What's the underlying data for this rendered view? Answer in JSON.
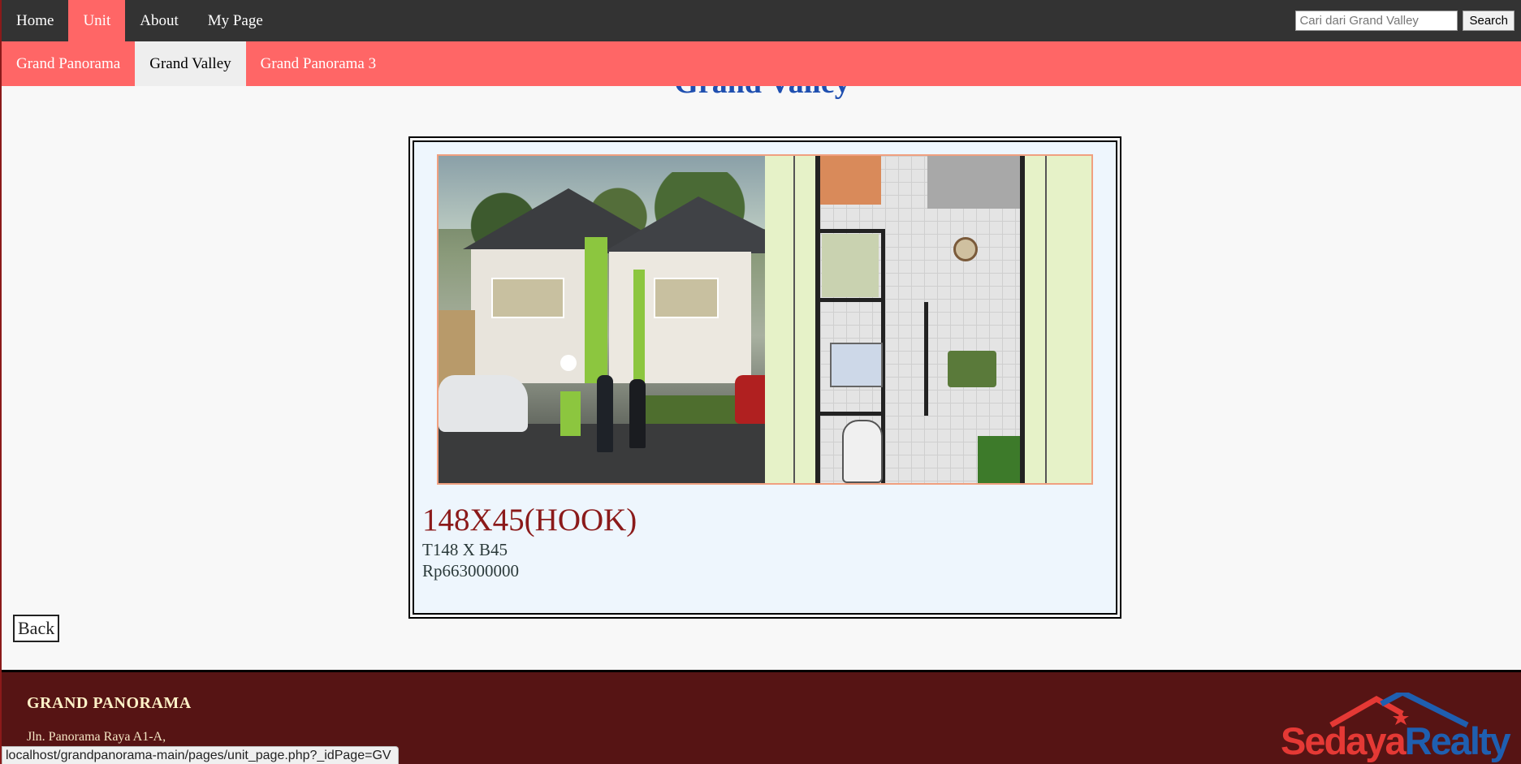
{
  "topnav": {
    "items": [
      {
        "label": "Home",
        "active": false
      },
      {
        "label": "Unit",
        "active": true
      },
      {
        "label": "About",
        "active": false
      },
      {
        "label": "My Page",
        "active": false
      }
    ],
    "search_placeholder": "Cari dari Grand Valley",
    "search_button": "Search"
  },
  "subnav": {
    "items": [
      {
        "label": "Grand Panorama",
        "active": false
      },
      {
        "label": "Grand Valley",
        "active": true
      },
      {
        "label": "Grand Panorama 3",
        "active": false
      }
    ]
  },
  "page": {
    "title": "Grand Valley"
  },
  "unit": {
    "name": "148X45(HOOK)",
    "size": "T148 X B45",
    "price": "Rp663000000"
  },
  "back_button": "Back",
  "footer": {
    "title": "GRAND PANORAMA",
    "address": "Jln. Panorama Raya A1-A,",
    "logo_part1": "Sedaya",
    "logo_part2": "Realty"
  },
  "statusbar": {
    "url": "localhost/grandpanorama-main/pages/unit_page.php?_idPage=GV"
  },
  "colors": {
    "topnav_bg": "#333333",
    "accent": "#ff6666",
    "title_blue": "#1f4fb0",
    "unit_name_red": "#8b1a1a",
    "footer_bg": "#561414",
    "logo_red": "#e53935",
    "logo_blue": "#1f5fb0"
  }
}
